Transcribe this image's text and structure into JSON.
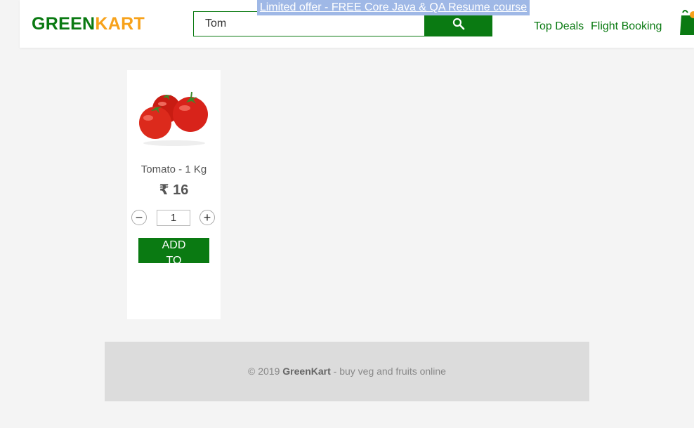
{
  "header": {
    "brand_part1": "GREEN",
    "brand_part2": "KART",
    "search": {
      "value": "Tom",
      "button_icon": "search-icon"
    },
    "promo": "Limited offer - FREE Core Java & QA Resume course",
    "nav": [
      "Top Deals",
      "Flight Booking"
    ],
    "cart_icon": "cart-icon"
  },
  "product": {
    "name": "Tomato - 1 Kg",
    "price": "₹ 16",
    "quantity": "1",
    "decrement": "−",
    "increment": "+",
    "add_label": "ADD TO CART",
    "image_icon": "tomato-image"
  },
  "footer": {
    "prefix": "© 2019",
    "brand": "GreenKart",
    "suffix": "- buy veg and fruits online"
  },
  "colors": {
    "primary": "#0a7a12",
    "accent": "#f7a21b",
    "promo_bg": "#9fb8e6"
  }
}
